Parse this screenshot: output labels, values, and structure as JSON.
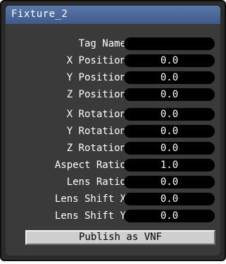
{
  "window": {
    "title": "Fixture_2"
  },
  "fields": [
    {
      "label": "Tag Name",
      "value": ""
    },
    {
      "label": "X Position",
      "value": "0.0"
    },
    {
      "label": "Y Position",
      "value": "0.0"
    },
    {
      "label": "Z Position",
      "value": "0.0"
    },
    {
      "label": "X Rotation",
      "value": "0.0"
    },
    {
      "label": "Y Rotation",
      "value": "0.0"
    },
    {
      "label": "Z Rotation",
      "value": "0.0"
    },
    {
      "label": "Aspect Ratio",
      "value": "1.0"
    },
    {
      "label": "Lens Ratio",
      "value": "0.0"
    },
    {
      "label": "Lens Shift X",
      "value": "0.0"
    },
    {
      "label": "Lens Shift Y",
      "value": "0.0"
    }
  ],
  "actions": {
    "publish_label": "Publish as VNF"
  },
  "colors": {
    "title_bar": "#4a6a9c",
    "panel": "#3a3a3a",
    "field": "#000000",
    "button": "#cfcfcf"
  }
}
